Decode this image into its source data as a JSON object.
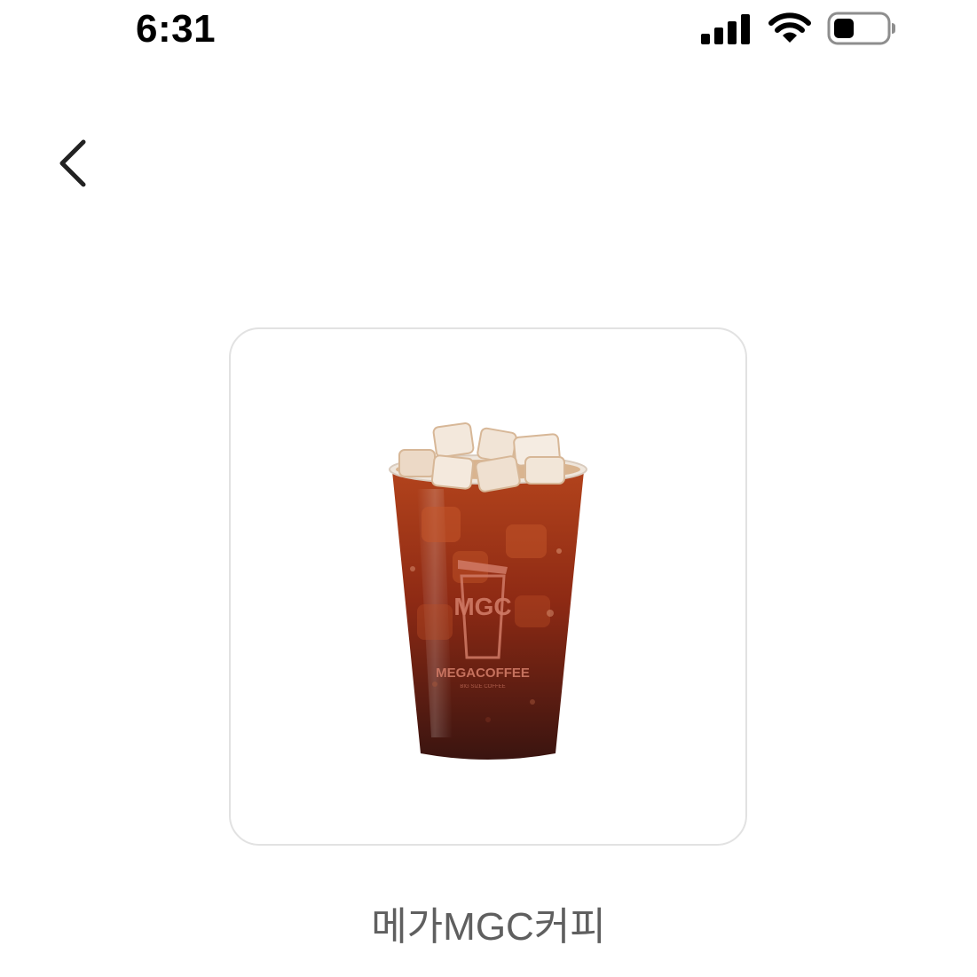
{
  "status_bar": {
    "time": "6:31",
    "icons": [
      "cellular-signal-icon",
      "wifi-icon",
      "battery-icon"
    ]
  },
  "nav": {
    "back_icon": "chevron-left-icon"
  },
  "product": {
    "brand_name": "메가MGC커피",
    "image": {
      "logo_text": "MGC",
      "brand_text": "MEGACOFFEE",
      "tagline": "BIG SIZE COFFEE"
    }
  },
  "colors": {
    "background": "#ffffff",
    "card_border": "#e2e2e2",
    "brand_text": "#5f5f5f",
    "coffee": "#8a2a12"
  }
}
